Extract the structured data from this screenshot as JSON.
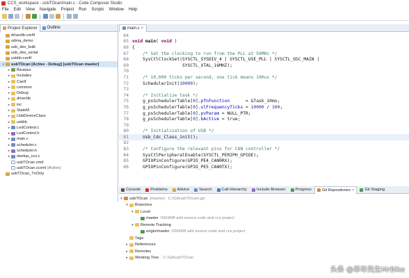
{
  "window": {
    "title": "CCS_workspace - usbTOcan/main.c - Code Composer Studio"
  },
  "menu": [
    "File",
    "Edit",
    "View",
    "Navigate",
    "Project",
    "Run",
    "Scripts",
    "Window",
    "Help"
  ],
  "left_tabs": [
    {
      "label": "Project Explorer",
      "icon": "project-explorer-icon"
    },
    {
      "label": "Outline",
      "icon": "outline-icon"
    }
  ],
  "project_tree": [
    {
      "label": "driverlib-cm4f",
      "dec": "",
      "indent": 0,
      "kind": "proj",
      "arrow": "",
      "selected": false
    },
    {
      "label": "udma_demo",
      "dec": "",
      "indent": 0,
      "kind": "proj",
      "arrow": "",
      "selected": false
    },
    {
      "label": "usb_dev_bulk",
      "dec": "",
      "indent": 0,
      "kind": "proj",
      "arrow": "",
      "selected": false
    },
    {
      "label": "usb_dev_serial",
      "dec": "",
      "indent": 0,
      "kind": "proj",
      "arrow": "",
      "selected": false
    },
    {
      "label": "usblib-cm4f",
      "dec": "",
      "indent": 0,
      "kind": "proj",
      "arrow": "",
      "selected": false
    },
    {
      "label": "usbTOcan  [Active - Debug] [usbTOcan master]",
      "dec": "",
      "indent": 0,
      "kind": "proj",
      "arrow": "▾",
      "selected": true,
      "bold": true
    },
    {
      "label": "Binaries",
      "dec": "",
      "indent": 1,
      "kind": "bin",
      "arrow": "▸",
      "selected": false
    },
    {
      "label": "Includes",
      "dec": "",
      "indent": 1,
      "kind": "folder",
      "arrow": "▸",
      "selected": false
    },
    {
      "label": "CanIf",
      "dec": "",
      "indent": 1,
      "kind": "folder",
      "arrow": "▸",
      "selected": false
    },
    {
      "label": "common",
      "dec": "",
      "indent": 1,
      "kind": "folder",
      "arrow": "▸",
      "selected": false
    },
    {
      "label": "Debug",
      "dec": "",
      "indent": 1,
      "kind": "folder",
      "arrow": "▸",
      "selected": false
    },
    {
      "label": "driverlib",
      "dec": "",
      "indent": 1,
      "kind": "folder",
      "arrow": "▸",
      "selected": false
    },
    {
      "label": "inc",
      "dec": "",
      "indent": 1,
      "kind": "folder",
      "arrow": "▸",
      "selected": false
    },
    {
      "label": "StateM",
      "dec": "",
      "indent": 1,
      "kind": "folder",
      "arrow": "▸",
      "selected": false
    },
    {
      "label": "UsbDeviceClass",
      "dec": "",
      "indent": 1,
      "kind": "folder",
      "arrow": "▸",
      "selected": false
    },
    {
      "label": "usblib",
      "dec": "",
      "indent": 1,
      "kind": "folder",
      "arrow": "▸",
      "selected": false
    },
    {
      "label": "LedControl.c",
      "dec": "",
      "indent": 1,
      "kind": "cfile",
      "arrow": "▸",
      "selected": false
    },
    {
      "label": "LedControl.h",
      "dec": "",
      "indent": 1,
      "kind": "hfile",
      "arrow": "▸",
      "selected": false
    },
    {
      "label": "main.c",
      "dec": "",
      "indent": 1,
      "kind": "cfile",
      "arrow": "▸",
      "selected": false
    },
    {
      "label": "scheduler.c",
      "dec": "",
      "indent": 1,
      "kind": "cfile",
      "arrow": "▸",
      "selected": false
    },
    {
      "label": "scheduler.h",
      "dec": "",
      "indent": 1,
      "kind": "hfile",
      "arrow": "▸",
      "selected": false
    },
    {
      "label": "startup_ccs.c",
      "dec": "",
      "indent": 1,
      "kind": "cfile",
      "arrow": "▸",
      "selected": false
    },
    {
      "label": "usbTOcan.cmd",
      "dec": "",
      "indent": 1,
      "kind": "file",
      "arrow": "",
      "selected": false
    },
    {
      "label": "usbTOcan.ccxml",
      "dec": "[Active]",
      "indent": 1,
      "kind": "file",
      "arrow": "",
      "selected": false
    },
    {
      "label": "usbTOcan_TxOnly",
      "dec": "",
      "indent": 0,
      "kind": "proj",
      "arrow": "",
      "selected": false
    }
  ],
  "editor": {
    "tab_label": "main.c",
    "lines": [
      {
        "n": "64",
        "html": ""
      },
      {
        "n": "65",
        "html": "<span class='kw'>void</span> <span class='bold'>main</span>( <span class='kw'>void</span> )"
      },
      {
        "n": "66",
        "html": "{"
      },
      {
        "n": "67",
        "html": "    <span class='cm'>/* Set the clocking to run from the PLL at 50MHz */</span>"
      },
      {
        "n": "68",
        "html": "    SysCtlClockSet(SYSCTL_SYSDIV_4 | SYSCTL_USE_PLL | SYSCTL_OSC_MAIN |"
      },
      {
        "n": "69",
        "html": "                   SYSCTL_XTAL_16MHZ);"
      },
      {
        "n": "70",
        "html": ""
      },
      {
        "n": "71",
        "html": "    <span class='cm'>/* 10,000 ticks per second, one tick means 100us */</span>"
      },
      {
        "n": "72",
        "html": "    SchedulerInit(<span class='num'>10000</span>);"
      },
      {
        "n": "73",
        "html": ""
      },
      {
        "n": "74",
        "html": "    <span class='cm'>/* Initialize task */</span>"
      },
      {
        "n": "75",
        "html": "    g_psSchedulerTable[<span class='num'>0</span>].<span class='fld'>pfnFunction</span>      = &amp;Task_10ms;"
      },
      {
        "n": "76",
        "html": "    g_psSchedulerTable[<span class='num'>0</span>].<span class='fld'>ulFrequencyTicks</span> = <span class='num'>10000</span> / <span class='num'>100</span>;"
      },
      {
        "n": "77",
        "html": "    g_psSchedulerTable[<span class='num'>0</span>].<span class='fld'>pvParam</span> = NULL_PTR;"
      },
      {
        "n": "78",
        "html": "    g_psSchedulerTable[<span class='num'>0</span>].<span class='fld'>bActive</span> = true;"
      },
      {
        "n": "79",
        "html": ""
      },
      {
        "n": "80",
        "html": "    <span class='cm'>/* Initialization of USB */</span>"
      },
      {
        "n": "81",
        "html": "    Usb_Cdc_Class_init();",
        "current": true
      },
      {
        "n": "82",
        "html": ""
      },
      {
        "n": "83",
        "html": "    <span class='cm'>/* Configure the relevant pins for CAN controller */</span>"
      },
      {
        "n": "84",
        "html": "    SysCtlPeripheralEnable(SYSCTL_PERIPH_GPIOE);"
      },
      {
        "n": "85",
        "html": "    GPIOPinConfigure(GPIO_PE4_CAN0RX);"
      },
      {
        "n": "86",
        "html": "    GPIOPinConfigure(GPIO_PE5_CAN0TX);"
      }
    ]
  },
  "bottom_tabs": [
    {
      "label": "Console",
      "icon": "console-icon",
      "active": false
    },
    {
      "label": "Problems",
      "icon": "problems-icon",
      "active": false
    },
    {
      "label": "Advice",
      "icon": "advice-icon",
      "active": false
    },
    {
      "label": "Search",
      "icon": "search-icon",
      "active": false
    },
    {
      "label": "Call Hierarchy",
      "icon": "call-hierarchy-icon",
      "active": false
    },
    {
      "label": "Include Browser",
      "icon": "include-browser-icon",
      "active": false
    },
    {
      "label": "Progress",
      "icon": "progress-icon",
      "active": false
    },
    {
      "label": "Git Repositories",
      "icon": "git-repositories-icon",
      "active": true
    },
    {
      "label": "Git Staging",
      "icon": "git-staging-icon",
      "active": false
    }
  ],
  "git_tree": [
    {
      "label": "usbTOcan",
      "gray": "[master] - C:\\Git\\usbTOcan\\.git",
      "indent": 0,
      "arrow": "▾",
      "kind": "repo"
    },
    {
      "label": "Branches",
      "gray": "",
      "indent": 1,
      "arrow": "▾",
      "kind": "folder"
    },
    {
      "label": "Local",
      "gray": "",
      "indent": 2,
      "arrow": "▾",
      "kind": "folder"
    },
    {
      "label": "master",
      "gray": "032d99f add source code and ccs project",
      "indent": 3,
      "arrow": "",
      "kind": "branch"
    },
    {
      "label": "Remote Tracking",
      "gray": "",
      "indent": 2,
      "arrow": "▾",
      "kind": "folder"
    },
    {
      "label": "origin/master",
      "gray": "032d99f add source code and ccs project",
      "indent": 3,
      "arrow": "",
      "kind": "branch"
    },
    {
      "label": "Tags",
      "gray": "",
      "indent": 1,
      "arrow": "",
      "kind": "folder"
    },
    {
      "label": "References",
      "gray": "",
      "indent": 1,
      "arrow": "▸",
      "kind": "folder"
    },
    {
      "label": "Remotes",
      "gray": "",
      "indent": 1,
      "arrow": "▸",
      "kind": "folder"
    },
    {
      "label": "Working Tree",
      "gray": "- C:\\Git\\usbTOcan",
      "indent": 1,
      "arrow": "▸",
      "kind": "folder"
    }
  ],
  "watermark": "头条 @单车先生MrBike",
  "colors": {
    "accent": "#d6e6f8",
    "tab_strip": "#e8eef6",
    "comment": "#3f7f5f",
    "keyword": "#7f0055"
  }
}
